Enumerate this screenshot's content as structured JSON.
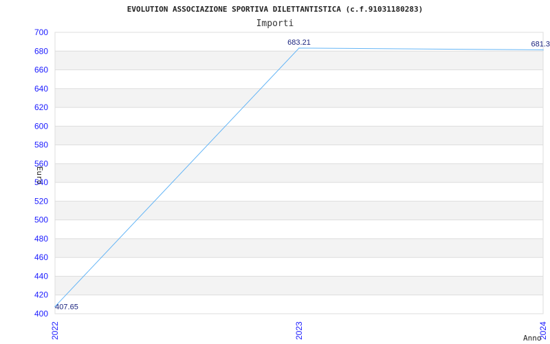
{
  "chart_data": {
    "type": "line",
    "title": "EVOLUTION ASSOCIAZIONE SPORTIVA DILETTANTISTICA (c.f.91031180283)",
    "subtitle": "Importi",
    "xlabel": "Anno",
    "ylabel": "Euro",
    "categories": [
      "2022",
      "2023",
      "2024"
    ],
    "values": [
      407.65,
      683.21,
      681.3
    ],
    "data_labels": [
      "407.65",
      "683.21",
      "681.3"
    ],
    "ylim": [
      400,
      700
    ],
    "yticks": [
      400,
      420,
      440,
      460,
      480,
      500,
      520,
      540,
      560,
      580,
      600,
      620,
      640,
      660,
      680,
      700
    ],
    "grid": true,
    "colors": {
      "line": "#64b5f6",
      "band": "#f3f3f3",
      "grid": "#dddddd",
      "tick": "#1a1aff",
      "data_label": "#1a237e"
    }
  }
}
